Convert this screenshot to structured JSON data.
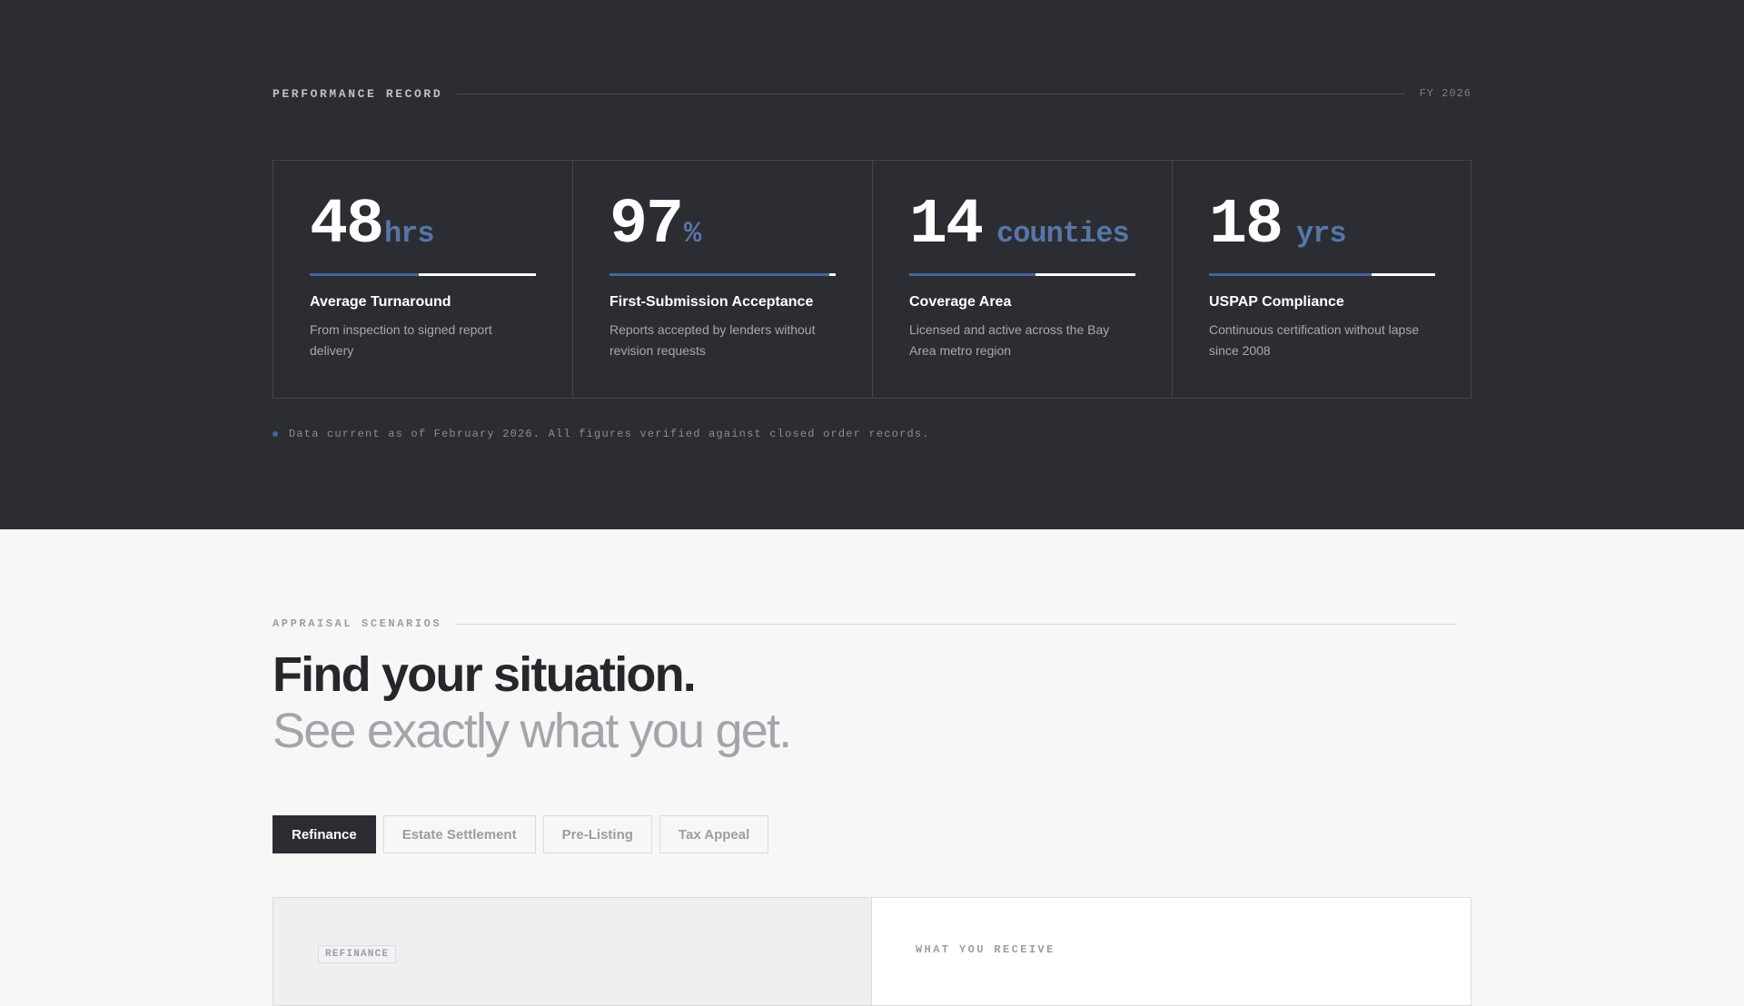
{
  "performance": {
    "label": "PERFORMANCE RECORD",
    "year": "FY 2026",
    "stats": [
      {
        "value": "48",
        "unit": "hrs",
        "progress": 0.48,
        "title": "Average Turnaround",
        "description": "From inspection to signed report delivery"
      },
      {
        "value": "97",
        "unit": "%",
        "progress": 0.97,
        "title": "First-Submission Acceptance",
        "description": "Reports accepted by lenders without revision requests"
      },
      {
        "value": "14",
        "unit": "counties",
        "progress": 0.56,
        "title": "Coverage Area",
        "description": "Licensed and active across the Bay Area metro region"
      },
      {
        "value": "18",
        "unit": "yrs",
        "progress": 0.72,
        "title": "USPAP Compliance",
        "description": "Continuous certification without lapse since 2008"
      }
    ],
    "note": "Data current as of February 2026. All figures verified against closed order records."
  },
  "scenarios": {
    "label": "APPRAISAL SCENARIOS",
    "headline": "Find your situation.",
    "subheadline": "See exactly what you get.",
    "tabs": [
      "Refinance",
      "Estate Settlement",
      "Pre-Listing",
      "Tax Appeal"
    ],
    "active_tab": "Refinance",
    "panel_badge": "REFINANCE",
    "receive_label": "WHAT YOU RECEIVE"
  },
  "colors": {
    "dark_bg": "#2c2d32",
    "accent": "#44659b",
    "unit_accent": "#5676a8",
    "light_bg": "#f7f7f7"
  }
}
